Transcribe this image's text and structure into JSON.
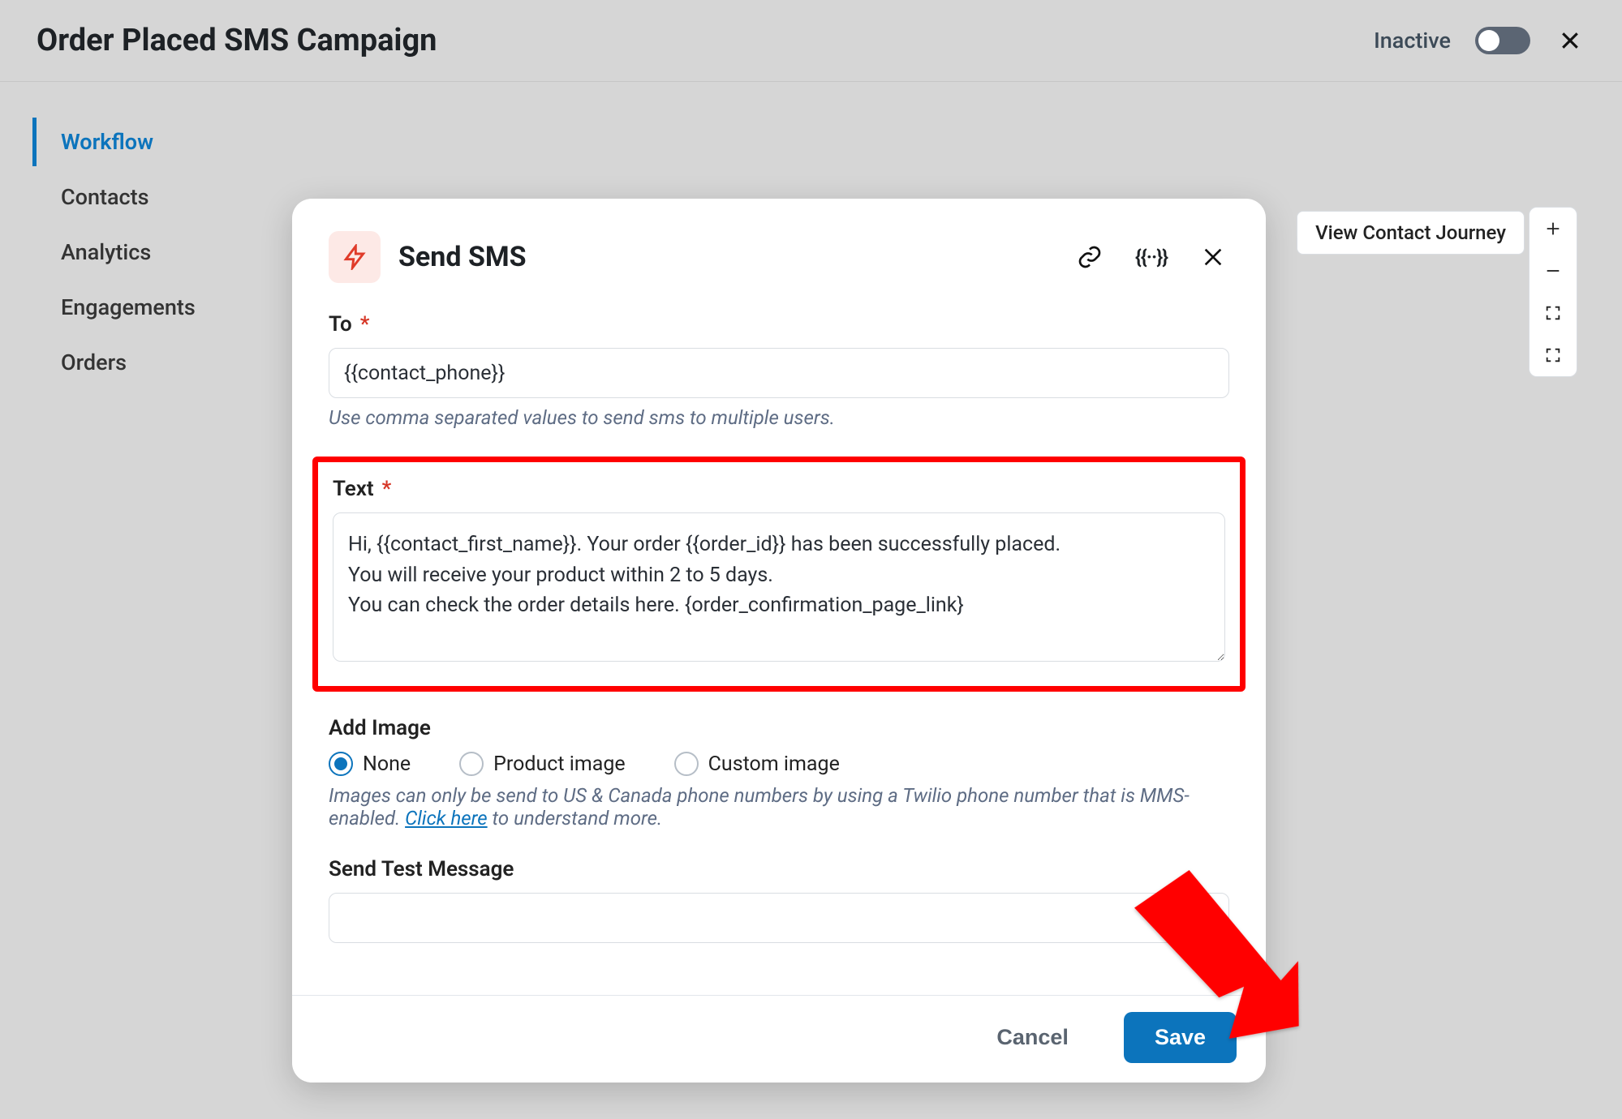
{
  "header": {
    "title": "Order Placed SMS Campaign",
    "status": "Inactive"
  },
  "sidebar": {
    "items": [
      {
        "label": "Workflow",
        "active": true
      },
      {
        "label": "Contacts",
        "active": false
      },
      {
        "label": "Analytics",
        "active": false
      },
      {
        "label": "Engagements",
        "active": false
      },
      {
        "label": "Orders",
        "active": false
      }
    ]
  },
  "canvas": {
    "journey_button": "View Contact Journey"
  },
  "modal": {
    "title": "Send SMS",
    "fields": {
      "to": {
        "label": "To",
        "value": "{{contact_phone}}",
        "helper": "Use comma separated values to send sms to multiple users."
      },
      "text": {
        "label": "Text",
        "value": "Hi, {{contact_first_name}}. Your order {{order_id}} has been successfully placed.\nYou will receive your product within 2 to 5 days.\nYou can check the order details here. {order_confirmation_page_link}"
      },
      "add_image": {
        "label": "Add Image",
        "options": [
          "None",
          "Product image",
          "Custom image"
        ],
        "selected": "None",
        "helper_pre": "Images can only be send to US & Canada phone numbers by using a Twilio phone number that is MMS-enabled. ",
        "helper_link": "Click here",
        "helper_post": " to understand more."
      },
      "test_message": {
        "label": "Send Test Message",
        "value": ""
      }
    },
    "footer": {
      "cancel": "Cancel",
      "save": "Save"
    }
  }
}
